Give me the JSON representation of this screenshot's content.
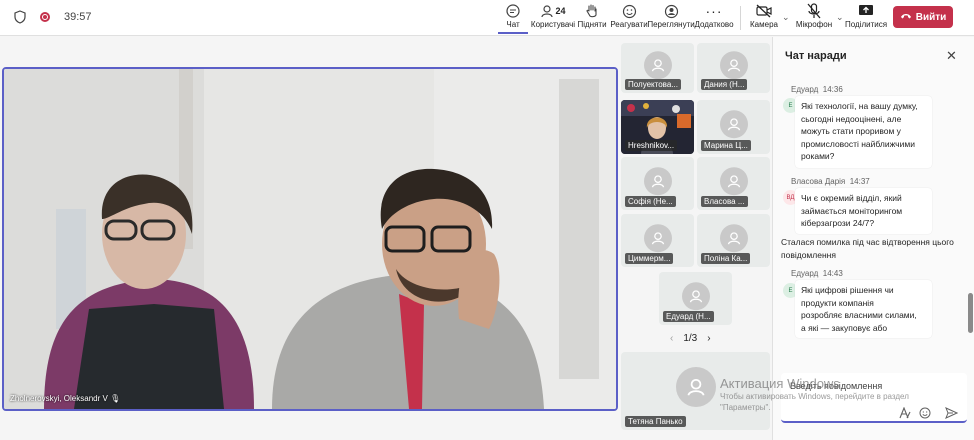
{
  "meeting": {
    "timer": "39:57"
  },
  "toolbar": {
    "chat": "Чат",
    "people": "Користувачі",
    "people_count": "24",
    "raise": "Підняти",
    "react": "Реагувати",
    "view": "Переглянути",
    "more": "Додатково",
    "camera": "Камера",
    "mic": "Мікрофон",
    "share": "Поділитися",
    "leave": "Вийти"
  },
  "main_video": {
    "name": "Zholnerovskyi, Oleksandr V"
  },
  "tiles": [
    {
      "name": "Полуектова..."
    },
    {
      "name": "Дания (Н..."
    },
    {
      "name": "Hreshnikov..."
    },
    {
      "name": "Марина Ц..."
    },
    {
      "name": "Софія (Не..."
    },
    {
      "name": "Власова ..."
    },
    {
      "name": "Циммерм..."
    },
    {
      "name": "Поліна Ка..."
    },
    {
      "name": "Едуард (Н..."
    },
    {
      "name": "Тетяна Панько"
    }
  ],
  "pager": {
    "label": "1/3"
  },
  "chat": {
    "title": "Чат наради",
    "messages": [
      {
        "author": "Едуард",
        "time": "14:36",
        "initials": "Е",
        "lines": [
          "Які технології, на вашу думку,",
          "сьогодні недооцінені, але",
          "можуть стати проривом у",
          "промисловості найближчими",
          "роками?"
        ]
      },
      {
        "author": "Власова Дарія",
        "time": "14:37",
        "initials": "ВД",
        "lines": [
          "Чи є окремий відділ, який",
          "займається моніторингом",
          "кіберзагрози 24/7?"
        ]
      },
      {
        "author": "Едуард",
        "time": "14:43",
        "initials": "Е",
        "lines": [
          "Які цифрові рішення чи",
          "продукти компанія",
          "розробляє власними силами,",
          "а які — закуповує або"
        ]
      }
    ],
    "error_lines": [
      "Сталася помилка під час відтворення цього",
      "повідомлення"
    ],
    "compose_placeholder": "Введіть повідомлення"
  },
  "watermark": {
    "line1": "Активация Windows",
    "line2": "Чтобы активировать Windows, перейдите в раздел",
    "line3": "\"Параметры\"."
  },
  "colors": {
    "accent": "#5b5fc7",
    "leave": "#c4314b"
  }
}
